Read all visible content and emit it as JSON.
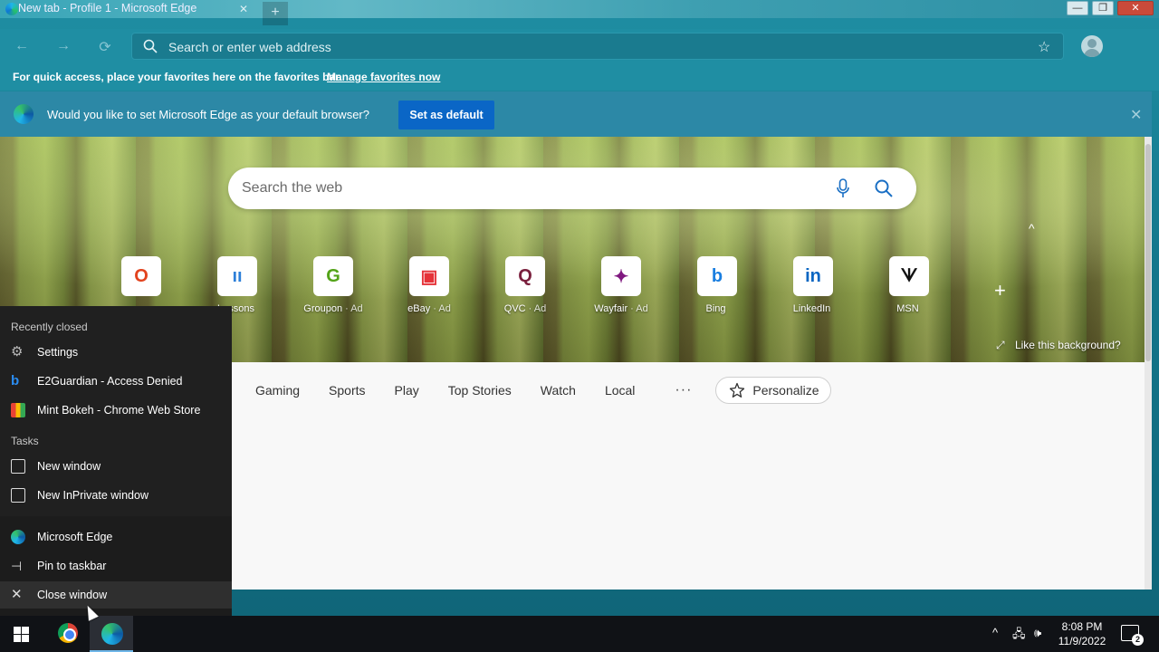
{
  "window": {
    "title": "New tab - Profile 1 - Microsoft Edge",
    "buttons": {
      "minimize": "—",
      "maximize": "❐",
      "close": "✕"
    },
    "newtab_symbol": "+"
  },
  "addressbar": {
    "placeholder": "Search or enter web address"
  },
  "favorites_bar": {
    "text": "For quick access, place your favorites here on the favorites bar.",
    "link": "Manage favorites now"
  },
  "banner": {
    "question": "Would you like to set Microsoft Edge as your default browser?",
    "button": "Set as default"
  },
  "ntp": {
    "search_placeholder": "Search the web",
    "tiles": [
      {
        "label": "",
        "ad": "",
        "icon": "office-icon",
        "glyph": "O",
        "color": "#e2431e"
      },
      {
        "label": "Lessons",
        "ad": "",
        "icon": "lessons-icon",
        "glyph": "ıı",
        "color": "#2d7fd8"
      },
      {
        "label": "Groupon",
        "ad": "· Ad",
        "icon": "groupon-icon",
        "glyph": "G",
        "color": "#53a318"
      },
      {
        "label": "eBay",
        "ad": "· Ad",
        "icon": "ebay-icon",
        "glyph": "▣",
        "color": "#e53238"
      },
      {
        "label": "QVC",
        "ad": "· Ad",
        "icon": "qvc-icon",
        "glyph": "Q",
        "color": "#7a1f3d"
      },
      {
        "label": "Wayfair",
        "ad": "· Ad",
        "icon": "wayfair-icon",
        "glyph": "✦",
        "color": "#7f187f"
      },
      {
        "label": "Bing",
        "ad": "",
        "icon": "bing-icon",
        "glyph": "b",
        "color": "#1a7ee0"
      },
      {
        "label": "LinkedIn",
        "ad": "",
        "icon": "linkedin-icon",
        "glyph": "in",
        "color": "#0a66c2"
      },
      {
        "label": "MSN",
        "ad": "",
        "icon": "msn-icon",
        "glyph": "ᗐ",
        "color": "#111"
      }
    ],
    "like_background": "Like this background?",
    "add_tile": "+",
    "collapse": "^"
  },
  "feed": {
    "tabs": [
      "Gaming",
      "Sports",
      "Play",
      "Top Stories",
      "Watch",
      "Local"
    ],
    "more": "···",
    "personalize": "Personalize"
  },
  "jumplist": {
    "recently_closed_header": "Recently closed",
    "recently_closed": [
      {
        "label": "Settings",
        "icon": "settings-gear-icon"
      },
      {
        "label": "E2Guardian - Access Denied",
        "icon": "bing-icon"
      },
      {
        "label": "Mint Bokeh - Chrome Web Store",
        "icon": "web-store-icon"
      }
    ],
    "tasks_header": "Tasks",
    "tasks": [
      {
        "label": "New window",
        "icon": "window-icon"
      },
      {
        "label": "New InPrivate window",
        "icon": "inprivate-window-icon"
      }
    ],
    "app": {
      "label": "Microsoft Edge"
    },
    "pin": {
      "label": "Pin to taskbar"
    },
    "close": {
      "label": "Close window"
    }
  },
  "taskbar": {
    "time": "8:08 PM",
    "date": "11/9/2022",
    "notifications": "2"
  }
}
